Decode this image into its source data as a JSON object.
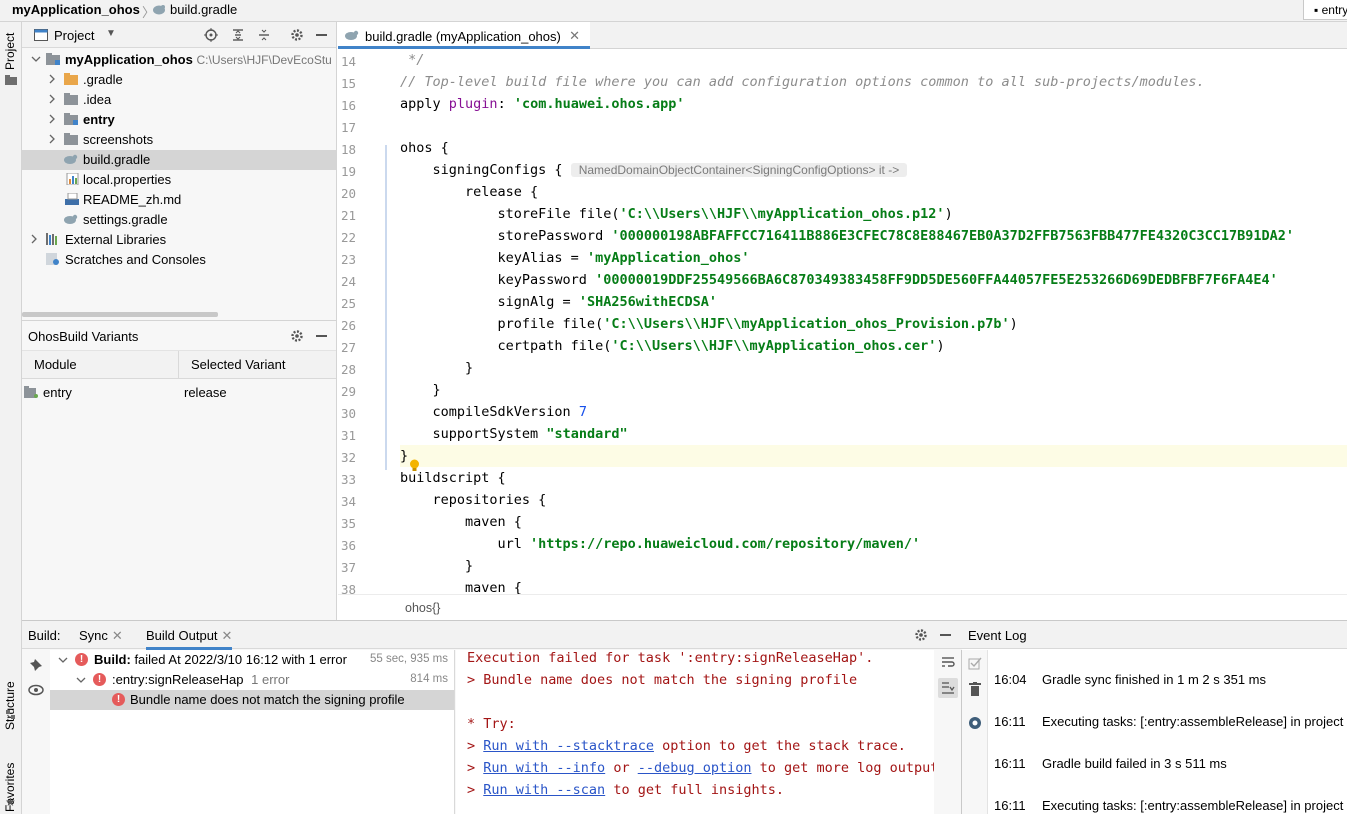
{
  "breadcrumb": {
    "project": "myApplication_ohos",
    "file": "build.gradle",
    "run_config": "entry"
  },
  "left_strip": {
    "project_label": "Project",
    "structure_label": "Structure",
    "favorites_label": "Favorites"
  },
  "project_panel": {
    "title": "Project",
    "root": {
      "name": "myApplication_ohos",
      "path": "C:\\Users\\HJF\\DevEcoStu"
    },
    "items": [
      {
        "label": ".gradle",
        "icon": "folder-orange-icon",
        "expandable": true,
        "bold": false
      },
      {
        "label": ".idea",
        "icon": "folder-icon",
        "expandable": true,
        "bold": false
      },
      {
        "label": "entry",
        "icon": "module-folder-icon",
        "expandable": true,
        "bold": true
      },
      {
        "label": "screenshots",
        "icon": "folder-icon",
        "expandable": true,
        "bold": false
      },
      {
        "label": "build.gradle",
        "icon": "gradle-icon",
        "expandable": false,
        "bold": false,
        "selected": true
      },
      {
        "label": "local.properties",
        "icon": "properties-icon",
        "expandable": false,
        "bold": false
      },
      {
        "label": "README_zh.md",
        "icon": "markdown-icon",
        "expandable": false,
        "bold": false
      },
      {
        "label": "settings.gradle",
        "icon": "gradle-icon",
        "expandable": false,
        "bold": false
      }
    ],
    "external_libraries": "External Libraries",
    "scratches": "Scratches and Consoles"
  },
  "variants": {
    "title": "OhosBuild Variants",
    "col_module": "Module",
    "col_variant": "Selected Variant",
    "row_module": "entry",
    "row_variant": "release"
  },
  "editor": {
    "tab_label": "build.gradle (myApplication_ohos)",
    "hint": "NamedDomainObjectContainer<SigningConfigOptions> it ->",
    "lines": [
      {
        "n": "14",
        "html": "<span class='cmt'> */</span>"
      },
      {
        "n": "15",
        "html": "<span class='cmt'>// Top-level build file where you can add configuration options common to all sub-projects/modules.</span>"
      },
      {
        "n": "16",
        "html": "apply <span class='plg'>plugin</span>: <span class='str'>'com.huawei.ohos.app'</span>"
      },
      {
        "n": "17",
        "html": ""
      },
      {
        "n": "18",
        "html": "ohos {"
      },
      {
        "n": "19",
        "html": "    signingConfigs { <span class='hint'>NamedDomainObjectContainer&lt;SigningConfigOptions&gt; it -&gt;</span>"
      },
      {
        "n": "20",
        "html": "        release {"
      },
      {
        "n": "21",
        "html": "            storeFile file(<span class='str'>'C:\\\\Users\\\\HJF\\\\myApplication_ohos.p12'</span>)"
      },
      {
        "n": "22",
        "html": "            storePassword <span class='str'>'000000198ABFAFFCC716411B886E3CFEC78C8E88467EB0A37D2FFB7563FBB477FE4320C3CC17B91DA2'</span>"
      },
      {
        "n": "23",
        "html": "            keyAlias = <span class='str'>'myApplication_ohos'</span>"
      },
      {
        "n": "24",
        "html": "            keyPassword <span class='str'>'00000019DDF25549566BA6C870349383458FF9DD5DE560FFA44057FE5E253266D69DEDBFBF7F6FA4E4'</span>"
      },
      {
        "n": "25",
        "html": "            signAlg = <span class='str'>'SHA256withECDSA'</span>"
      },
      {
        "n": "26",
        "html": "            profile file(<span class='str'>'C:\\\\Users\\\\HJF\\\\myApplication_ohos_Provision.p7b'</span>)"
      },
      {
        "n": "27",
        "html": "            certpath file(<span class='str'>'C:\\\\Users\\\\HJF\\\\myApplication_ohos.cer'</span>)"
      },
      {
        "n": "28",
        "html": "        }"
      },
      {
        "n": "29",
        "html": "    }"
      },
      {
        "n": "30",
        "html": "    compileSdkVersion <span class='num'>7</span>"
      },
      {
        "n": "31",
        "html": "    supportSystem <span class='str'>\"standard\"</span>"
      },
      {
        "n": "32",
        "html": "}",
        "current": true
      },
      {
        "n": "33",
        "html": "buildscript {"
      },
      {
        "n": "34",
        "html": "    repositories {"
      },
      {
        "n": "35",
        "html": "        maven {"
      },
      {
        "n": "36",
        "html": "            url <span class='str'>'https://repo.huaweicloud.com/repository/maven/'</span>"
      },
      {
        "n": "37",
        "html": "        }"
      },
      {
        "n": "38",
        "html": "        maven {"
      }
    ],
    "breadcrumb_bottom": "ohos{}"
  },
  "build_panel": {
    "label": "Build:",
    "tabs": [
      "Sync",
      "Build Output"
    ],
    "tree": [
      {
        "text_bold": "Build:",
        "text": " failed At 2022/3/10 16:12 with 1 error",
        "time": "55 sec, 935 ms"
      },
      {
        "text": ":entry:signReleaseHap",
        "suffix": "1 error",
        "time": "814 ms"
      },
      {
        "text": "Bundle name does not match the signing profile"
      }
    ],
    "console": [
      "Execution failed for task ':entry:signReleaseHap'.",
      "> Bundle name does not match the signing profile",
      "",
      "* Try:"
    ],
    "console_links": [
      {
        "prefix": "> ",
        "link": "Run with --stacktrace",
        "rest": " option to get the stack trace."
      },
      {
        "prefix": "> ",
        "link": "Run with --info",
        "mid": " or ",
        "link2": "--debug option",
        "rest": " to get more log output."
      },
      {
        "prefix": "> ",
        "link": "Run with --scan",
        "rest": " to get full insights."
      }
    ]
  },
  "event_log": {
    "title": "Event Log",
    "entries": [
      {
        "time": "16:04",
        "msg": "Gradle sync finished in 1 m 2 s 351 ms"
      },
      {
        "time": "16:11",
        "msg": "Executing tasks: [:entry:assembleRelease] in project C"
      },
      {
        "time": "16:11",
        "msg": "Gradle build failed in 3 s 511 ms"
      },
      {
        "time": "16:11",
        "msg": "Executing tasks: [:entry:assembleRelease] in project C"
      }
    ]
  },
  "colors": {
    "accent": "#4083c9",
    "string": "#067d17",
    "error": "#e55b5b",
    "console_error": "#a31515",
    "link": "#2a55c8"
  }
}
